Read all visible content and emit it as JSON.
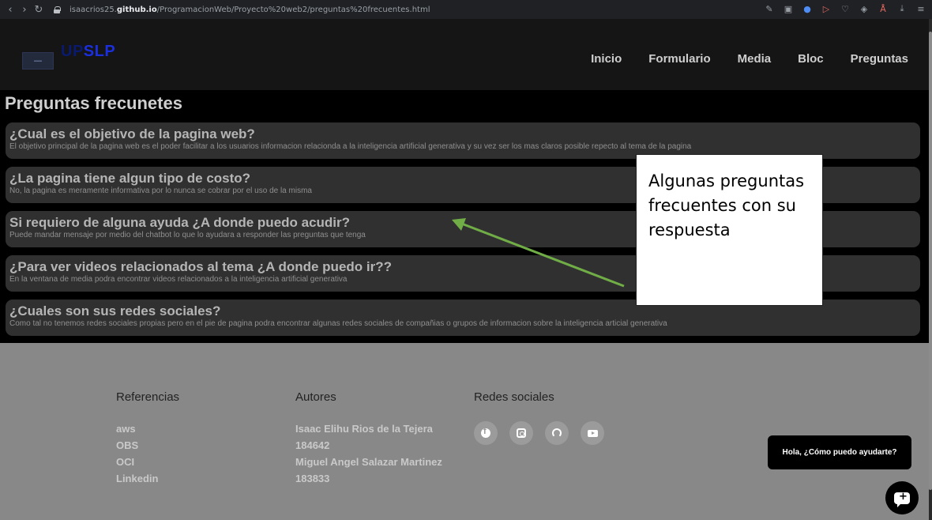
{
  "browser": {
    "url_prefix": "isaacrios25.",
    "url_domain": "github.io",
    "url_path": "/ProgramacionWeb/Proyecto%20web2/preguntas%20frecuentes.html",
    "back_icon": "back-icon",
    "forward_icon": "forward-icon",
    "reload_icon": "reload-icon"
  },
  "header": {
    "brand_part1": "UP",
    "brand_part2": "SLP",
    "nav": [
      {
        "label": "Inicio"
      },
      {
        "label": "Formulario"
      },
      {
        "label": "Media"
      },
      {
        "label": "Bloc"
      },
      {
        "label": "Preguntas"
      }
    ]
  },
  "faq": {
    "title": "Preguntas frecunetes",
    "items": [
      {
        "question": "¿Cual es el objetivo de la pagina web?",
        "answer": "El objetivo principal de la pagina web es el poder facilitar a los usuarios informacion relacionda a la inteligencia artificial generativa y su vez ser los mas claros posible repecto al tema de la pagina"
      },
      {
        "question": "¿La pagina tiene algun tipo de costo?",
        "answer": "No, la pagina es meramente informativa por lo nunca se cobrar por el uso de la misma"
      },
      {
        "question": "Si requiero de alguna ayuda ¿A donde puedo acudir?",
        "answer": "Puede mandar mensaje por medio del chatbot lo que lo ayudara a responder las preguntas que tenga"
      },
      {
        "question": "¿Para ver videos relacionados al tema ¿A donde puedo ir??",
        "answer": "En la ventana de media podra encontrar videos relacionados a la inteligencia artificial generativa"
      },
      {
        "question": "¿Cuales son sus redes sociales?",
        "answer": "Como tal no tenemos redes sociales propias pero en el pie de pagina podra encontrar algunas redes sociales de compañias o grupos de informacion sobre la inteligencia articial generativa"
      }
    ]
  },
  "annotation": {
    "text": "Algunas preguntas frecuentes con su respuesta",
    "color": "#70ad47"
  },
  "footer": {
    "references": {
      "heading": "Referencias",
      "items": [
        "aws",
        "OBS",
        "OCI",
        "Linkedin"
      ]
    },
    "authors": {
      "heading": "Autores",
      "items": [
        "Isaac Elihu Rios de la Tejera",
        "184642",
        "Miguel Angel Salazar Martinez",
        "183833"
      ]
    },
    "socials": {
      "heading": "Redes sociales",
      "icons": [
        "facebook-icon",
        "instagram-icon",
        "github-icon",
        "youtube-icon"
      ]
    }
  },
  "chat": {
    "bubble_text": "Hola, ¿Cómo puedo ayudarte?"
  }
}
